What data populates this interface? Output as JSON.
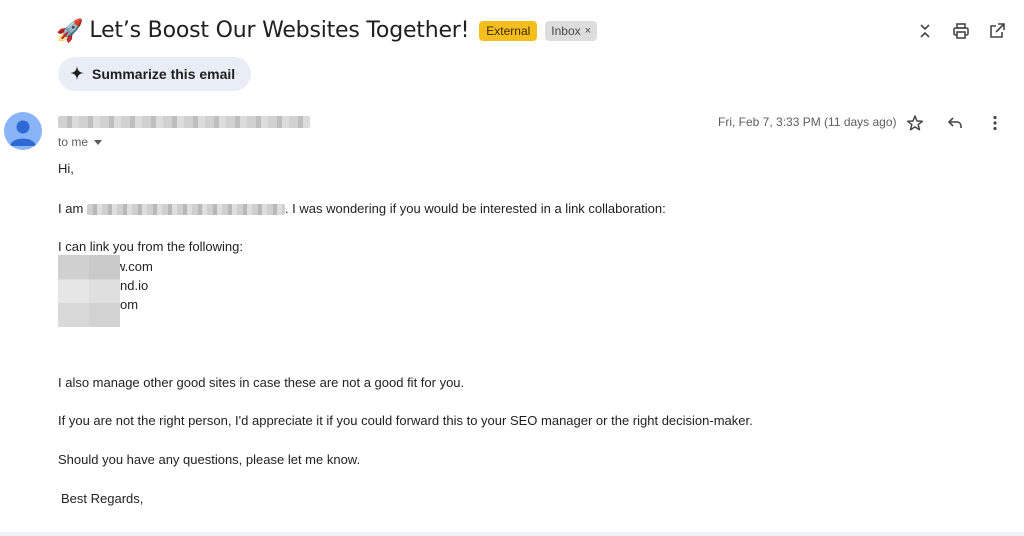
{
  "header": {
    "subject_emoji": "🚀",
    "subject": "Let’s Boost Our Websites Together!",
    "labels": {
      "external": "External",
      "inbox": "Inbox",
      "remove_symbol": "×"
    }
  },
  "toolbar": {
    "icons": [
      "collapse-icon",
      "print-icon",
      "open-in-new-window-icon"
    ]
  },
  "summarize": {
    "label": "Summarize this email",
    "icon": "sparkle-icon"
  },
  "message": {
    "recipient": "to me",
    "date": "Fri, Feb 7, 3:33 PM (11 days ago)",
    "icons": [
      "star-icon",
      "reply-icon",
      "more-vert-icon"
    ],
    "body": {
      "greeting": "Hi,",
      "intro_start": "I am",
      "intro_end": ". I was wondering if you would be interested in a link collaboration:",
      "link_intro": "I can link you from the following:",
      "site_fragments": [
        "w.com",
        "nd.io",
        "om"
      ],
      "other_sites": "I also manage other good sites in case these are not a good fit for you.",
      "forward": "If you are not the right person, I'd appreciate it if you could forward this to your SEO manager or the right decision-maker.",
      "questions": "Should you have any questions, please let me know.",
      "signoff": "Best Regards,"
    }
  },
  "colors": {
    "external_badge": "#f6be1d",
    "summarize_bg": "#e9eef6",
    "avatar": "#8ab4f8"
  }
}
